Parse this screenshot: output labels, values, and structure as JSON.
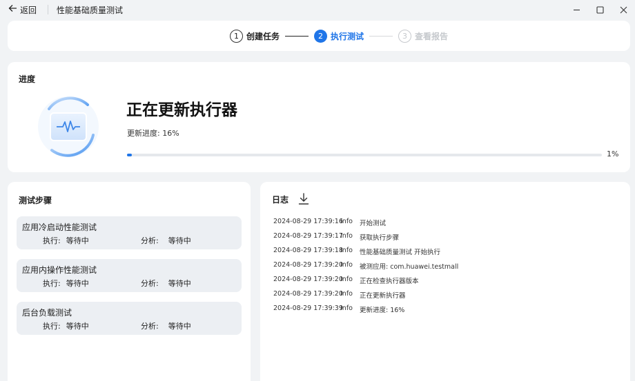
{
  "titlebar": {
    "back_label": "返回",
    "window_title": "性能基础质量测试"
  },
  "stepper": {
    "steps": [
      {
        "number": "1",
        "label": "创建任务",
        "state": "done"
      },
      {
        "number": "2",
        "label": "执行测试",
        "state": "active"
      },
      {
        "number": "3",
        "label": "查看报告",
        "state": "pending"
      }
    ]
  },
  "progress": {
    "title": "进度",
    "status": "正在更新执行器",
    "update_label": "更新进度:",
    "update_value": "16%",
    "bar_fraction": 0.01,
    "bar_percent_label": "1%"
  },
  "test_steps": {
    "title": "测试步骤",
    "items": [
      {
        "name": "应用冷启动性能测试",
        "exec_label": "执行:",
        "exec_value": "等待中",
        "analysis_label": "分析:",
        "analysis_value": "等待中"
      },
      {
        "name": "应用内操作性能测试",
        "exec_label": "执行:",
        "exec_value": "等待中",
        "analysis_label": "分析:",
        "analysis_value": "等待中"
      },
      {
        "name": "后台负载测试",
        "exec_label": "执行:",
        "exec_value": "等待中",
        "analysis_label": "分析:",
        "analysis_value": "等待中"
      }
    ]
  },
  "log": {
    "title": "日志",
    "entries": [
      {
        "time": "2024-08-29 17:39:16",
        "level": "Info",
        "message": "开始测试"
      },
      {
        "time": "2024-08-29 17:39:17",
        "level": "Info",
        "message": "获取执行步骤"
      },
      {
        "time": "2024-08-29 17:39:18",
        "level": "Info",
        "message": "性能基础质量测试 开始执行"
      },
      {
        "time": "2024-08-29 17:39:20",
        "level": "Info",
        "message": "被测应用: com.huawei.testmall"
      },
      {
        "time": "2024-08-29 17:39:20",
        "level": "Info",
        "message": "正在检查执行器版本"
      },
      {
        "time": "2024-08-29 17:39:20",
        "level": "Info",
        "message": "正在更新执行器"
      },
      {
        "time": "2024-08-29 17:39:39",
        "level": "Info",
        "message": "更新进度: 16%"
      }
    ]
  },
  "colors": {
    "accent": "#1f75e8",
    "background": "#f1f3f5",
    "card": "#ffffff",
    "step_item": "#eceff3"
  }
}
